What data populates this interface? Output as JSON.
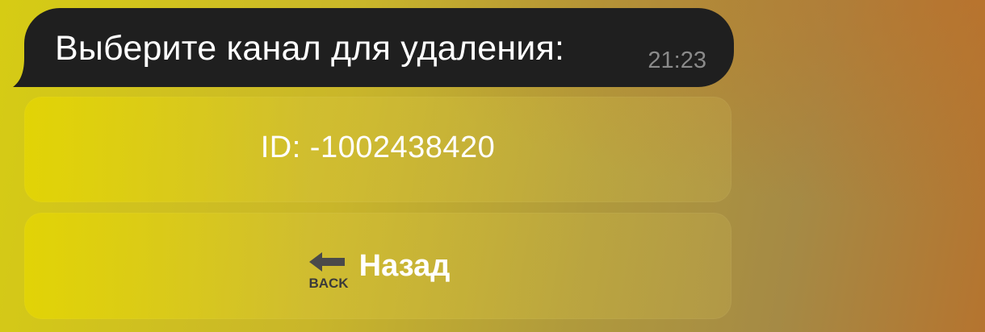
{
  "message": {
    "text": "Выберите канал для удаления:",
    "time": "21:23"
  },
  "keyboard": {
    "buttons": [
      {
        "label": "ID: -1002438420"
      },
      {
        "label": "Назад",
        "icon": "back-arrow-icon",
        "icon_text": "BACK"
      }
    ]
  },
  "colors": {
    "bubble": "#1f1f1f",
    "time_text": "#8a8a8a",
    "button_text": "#ffffff"
  }
}
